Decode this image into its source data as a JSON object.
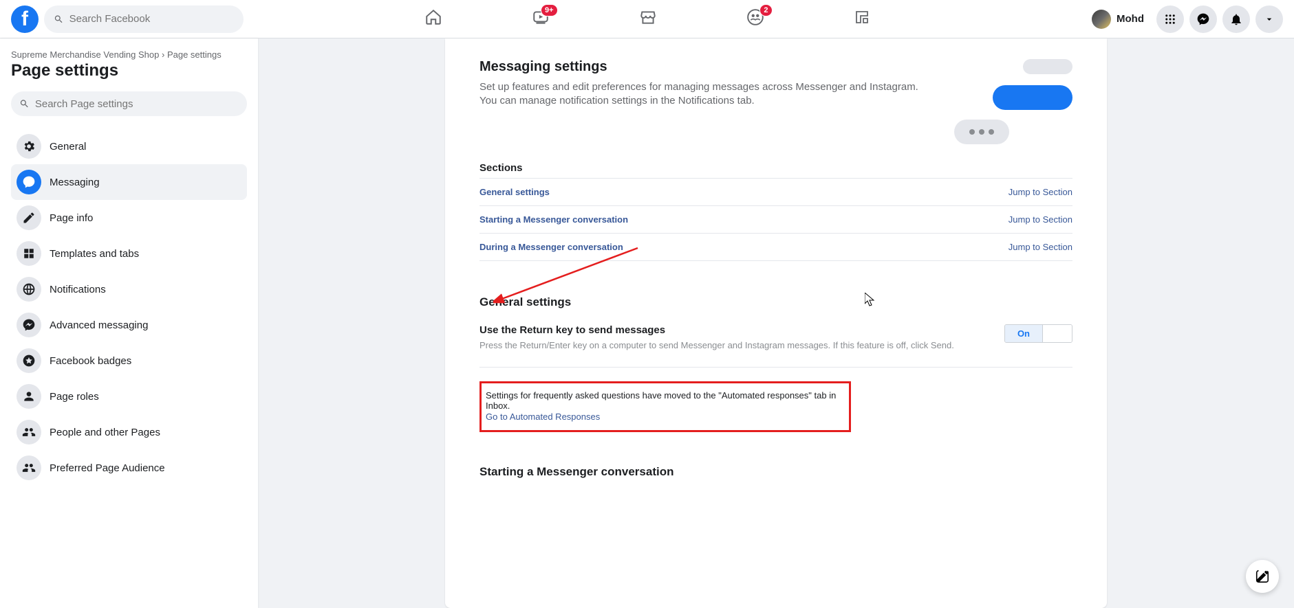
{
  "header": {
    "search_placeholder": "Search Facebook",
    "username": "Mohd",
    "badges": {
      "watch": "9+",
      "groups": "2"
    }
  },
  "breadcrumb": {
    "parent": "Supreme Merchandise Vending Shop",
    "current": "Page settings"
  },
  "sidebar": {
    "title": "Page settings",
    "search_placeholder": "Search Page settings",
    "items": [
      {
        "label": "General"
      },
      {
        "label": "Messaging"
      },
      {
        "label": "Page info"
      },
      {
        "label": "Templates and tabs"
      },
      {
        "label": "Notifications"
      },
      {
        "label": "Advanced messaging"
      },
      {
        "label": "Facebook badges"
      },
      {
        "label": "Page roles"
      },
      {
        "label": "People and other Pages"
      },
      {
        "label": "Preferred Page Audience"
      }
    ]
  },
  "main": {
    "hero_title": "Messaging settings",
    "hero_desc": "Set up features and edit preferences for managing messages across Messenger and Instagram. You can manage notification settings in the Notifications tab.",
    "sections_label": "Sections",
    "jump_label": "Jump to Section",
    "section_links": [
      {
        "label": "General settings"
      },
      {
        "label": "Starting a Messenger conversation"
      },
      {
        "label": "During a Messenger conversation"
      }
    ],
    "general": {
      "heading": "General settings",
      "return_key_title": "Use the Return key to send messages",
      "return_key_desc": "Press the Return/Enter key on a computer to send Messenger and Instagram messages. If this feature is off, click Send.",
      "toggle_on": "On",
      "faq_notice": "Settings for frequently asked questions have moved to the \"Automated responses\" tab in Inbox.",
      "faq_link": "Go to Automated Responses"
    },
    "starting": {
      "heading": "Starting a Messenger conversation"
    }
  }
}
